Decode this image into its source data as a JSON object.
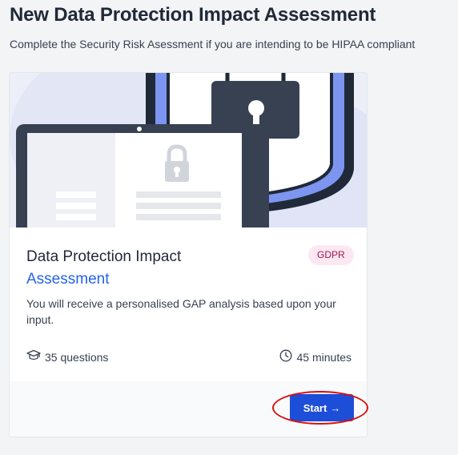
{
  "header": {
    "title": "New Data Protection Impact Assessment",
    "subtitle": "Complete the Security Risk Asessment if you are intending to be HIPAA compliant"
  },
  "card": {
    "title_line1": "Data Protection Impact",
    "title_line2": "Assessment",
    "badge": "GDPR",
    "description": "You will receive a personalised GAP analysis based upon your input.",
    "questions": "35 questions",
    "duration": "45 minutes",
    "start_label": "Start",
    "start_arrow": "→",
    "icons": [
      "laptop-lock-illustration",
      "shield-lock-illustration",
      "graduation-cap-icon",
      "clock-icon",
      "arrow-right-icon"
    ]
  },
  "colors": {
    "accent": "#2563eb",
    "button": "#1d4ed8",
    "badge_bg": "#fce7f3",
    "badge_text": "#9d174d",
    "highlight": "#d90f0f"
  }
}
